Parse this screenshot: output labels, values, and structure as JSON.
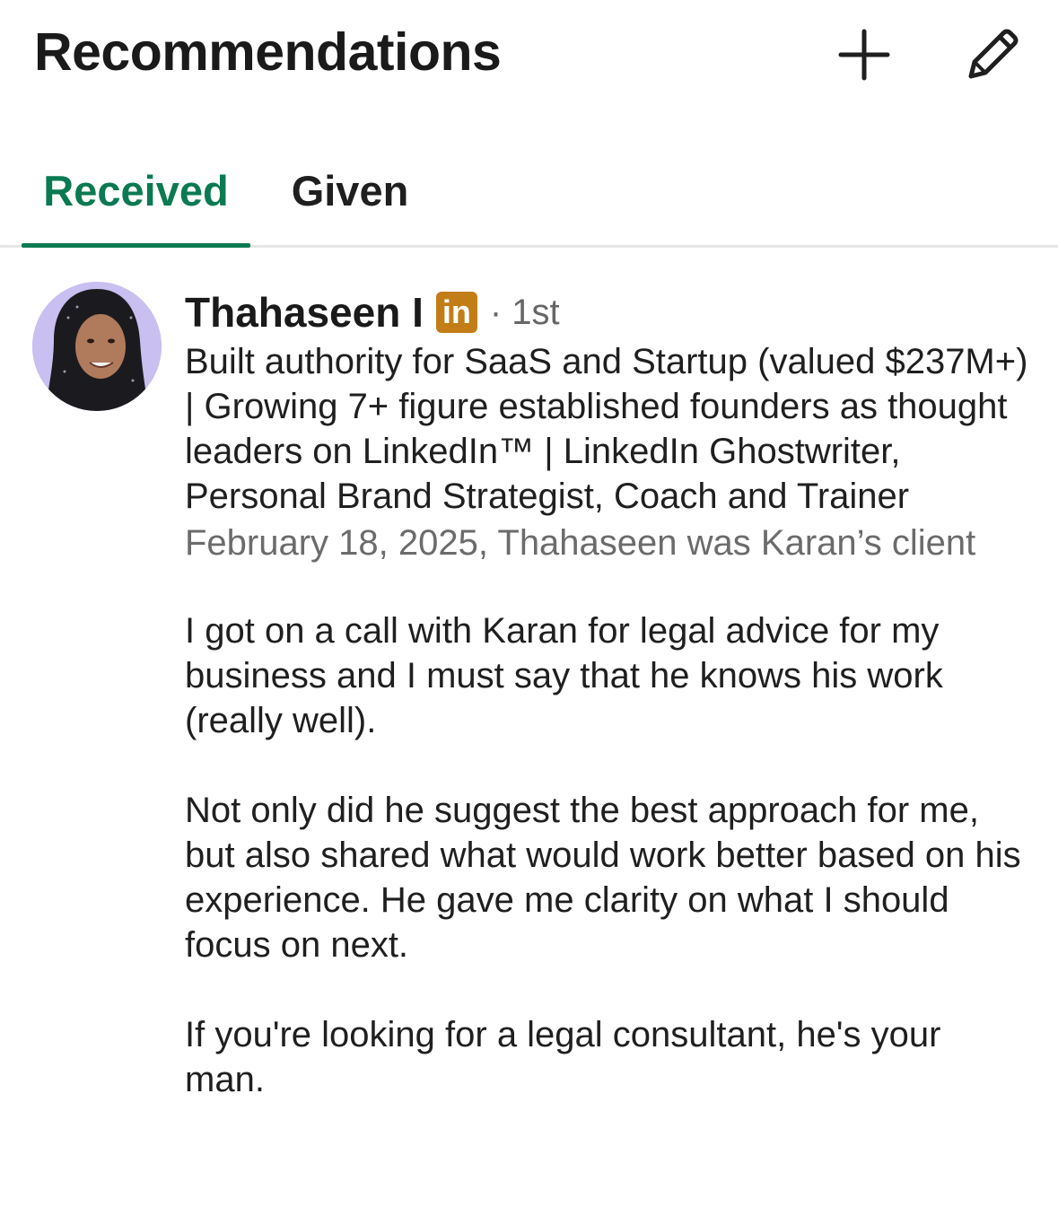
{
  "header": {
    "title": "Recommendations",
    "add_icon": "plus-icon",
    "edit_icon": "pencil-icon"
  },
  "tabs": [
    {
      "label": "Received",
      "active": true
    },
    {
      "label": "Given",
      "active": false
    }
  ],
  "colors": {
    "active_tab": "#0b7a52",
    "linkedin_badge": "#c37d16",
    "avatar_bg": "#c9bff0"
  },
  "recommendation": {
    "name": "Thahaseen I",
    "badge_label": "in",
    "badge_icon": "linkedin-badge-icon",
    "degree": "· 1st",
    "headline": "Built authority for SaaS and Startup (valued $237M+) | Growing 7+ figure established founders as thought leaders on LinkedIn™ | LinkedIn Ghostwriter, Personal Brand Strategist, Coach and Trainer",
    "meta": "February 18, 2025, Thahaseen was Karan’s client",
    "paragraphs": [
      "I got on a call with Karan for legal advice for my business and I must say that he knows his work (really well).",
      "Not only did he suggest the best approach for me, but also shared what would work better based on his experience. He gave me clarity on what I should focus on next.",
      "If you're looking for a legal consultant, he's your man."
    ]
  }
}
